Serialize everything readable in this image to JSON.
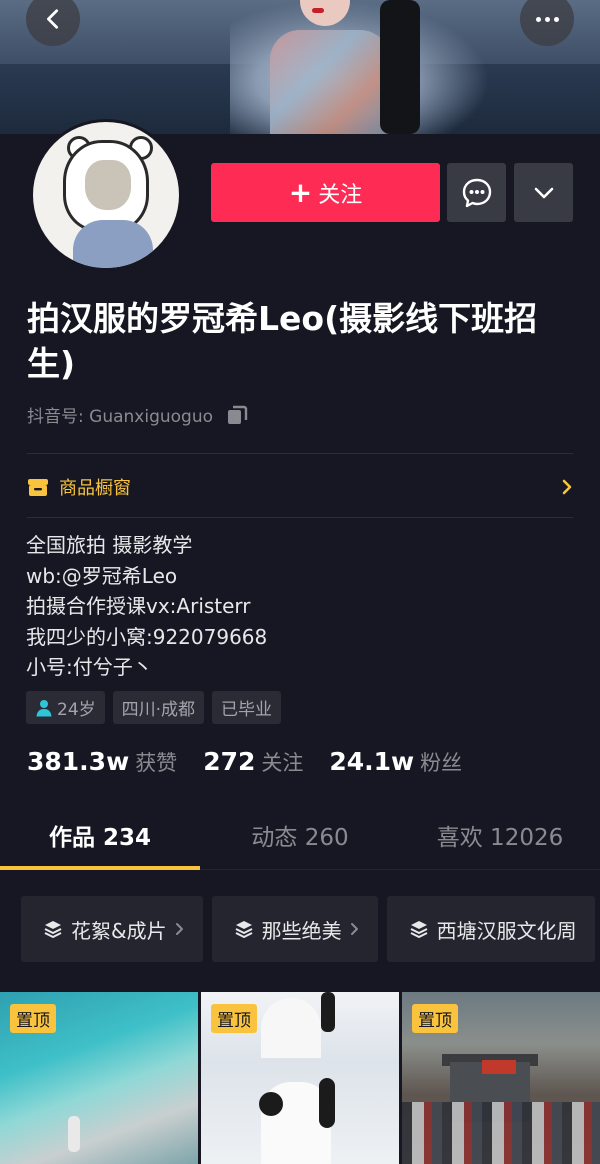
{
  "profile": {
    "name": "拍汉服的罗冠希Leo(摄影线下班招生)",
    "douyin_id_label": "抖音号:",
    "douyin_id": "Guanxiguoguo",
    "follow_label": "关注",
    "follow_plus": "+",
    "accent_color": "#fe2c55"
  },
  "shop": {
    "label": "商品橱窗",
    "color": "#f9c33d"
  },
  "bio": [
    "全国旅拍 摄影教学",
    "wb:@罗冠希Leo",
    "拍摄合作授课vx:Aristerr",
    "我四少的小窝:922079668",
    "小号:付兮子丶"
  ],
  "tags": {
    "age": "24岁",
    "location": "四川·成都",
    "education": "已毕业"
  },
  "stats": {
    "likes_num": "381.3w",
    "likes_label": "获赞",
    "following_num": "272",
    "following_label": "关注",
    "followers_num": "24.1w",
    "followers_label": "粉丝"
  },
  "tabs": {
    "works": "作品 234",
    "dynamic": "动态 260",
    "likes": "喜欢 12026"
  },
  "collections": {
    "c1": "花絮&成片",
    "c2": "那些绝美",
    "c3": "西塘汉服文化周"
  },
  "videos": {
    "pin1": "置顶",
    "pin2": "置顶",
    "pin3": "置顶"
  }
}
